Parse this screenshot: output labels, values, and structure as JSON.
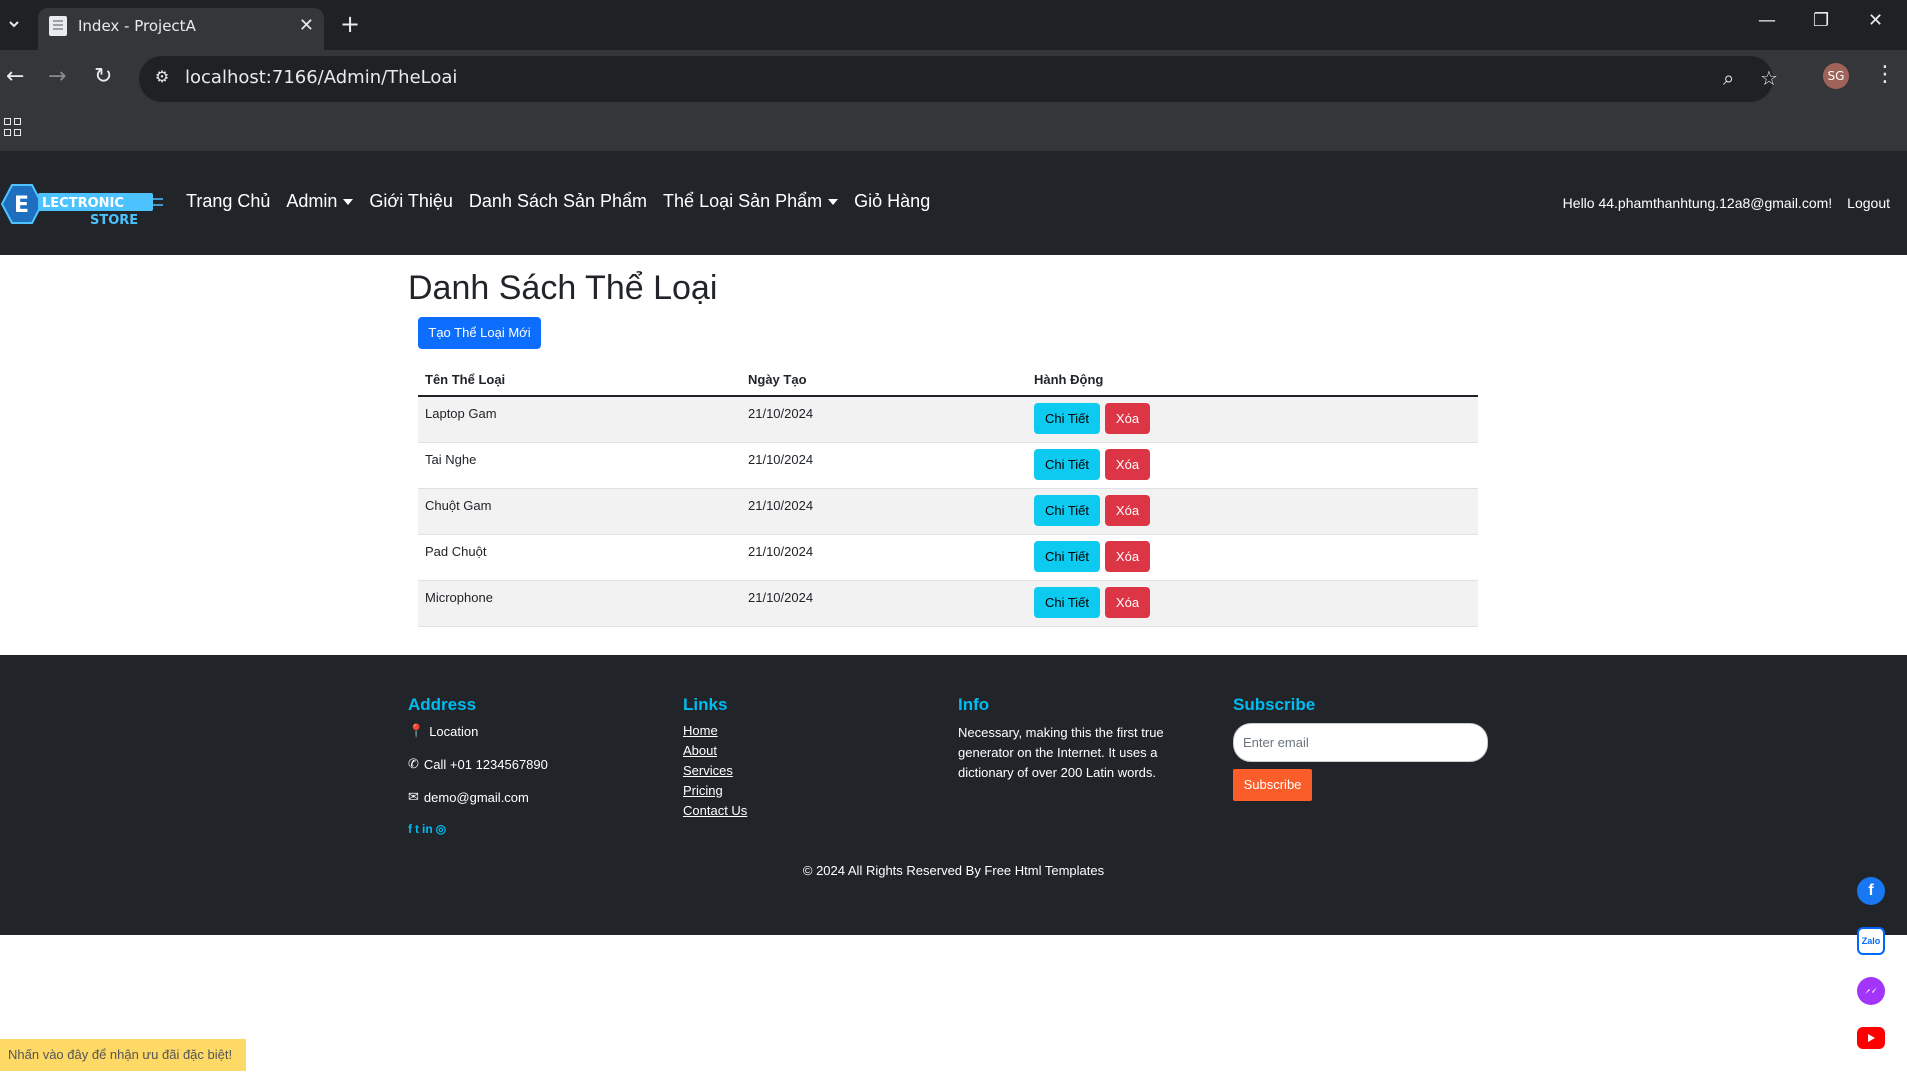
{
  "browser": {
    "tab_title": "Index - ProjectA",
    "url": "localhost:7166/Admin/TheLoai",
    "profile_initials": "SG"
  },
  "nav": {
    "logo_text_1": "LECTRONIC",
    "logo_text_2": "STORE",
    "home": "Trang Chủ",
    "admin": "Admin",
    "about": "Giới Thiệu",
    "products": "Danh Sách Sản Phẩm",
    "categories": "Thể Loại Sản Phẩm",
    "cart": "Giỏ Hàng",
    "greeting": "Hello 44.phamthanhtung.12a8@gmail.com!",
    "logout": "Logout"
  },
  "main": {
    "title": "Danh Sách Thể Loại",
    "create_button": "Tạo Thể Loại Mới",
    "columns": [
      "Tên Thể Loại",
      "Ngày Tạo",
      "Hành Động"
    ],
    "rows": [
      {
        "name": "Laptop Gam",
        "date": "21/10/2024"
      },
      {
        "name": "Tai Nghe",
        "date": "21/10/2024"
      },
      {
        "name": "Chuột Gam",
        "date": "21/10/2024"
      },
      {
        "name": "Pad Chuột",
        "date": "21/10/2024"
      },
      {
        "name": "Microphone",
        "date": "21/10/2024"
      }
    ],
    "detail_label": "Chi Tiết",
    "delete_label": "Xóa"
  },
  "footer": {
    "address_heading": "Address",
    "location": "Location",
    "phone": "Call +01 1234567890",
    "email": "demo@gmail.com",
    "links_heading": "Links",
    "links": [
      "Home",
      "About",
      "Services",
      "Pricing",
      "Contact Us"
    ],
    "info_heading": "Info",
    "info_text": "Necessary, making this the first true generator on the Internet. It uses a dictionary of over 200 Latin words.",
    "subscribe_heading": "Subscribe",
    "email_placeholder": "Enter email",
    "subscribe_button": "Subscribe",
    "copyright": "© 2024 All Rights Reserved By Free Html Templates"
  },
  "promo": "Nhấn vào đây để nhận ưu đãi đặc biệt!",
  "colors": {
    "accent": "#00bbf0",
    "primary": "#0d6efd",
    "danger": "#dc3545",
    "info": "#0dcaf0",
    "subscribe": "#fa5d2a"
  }
}
